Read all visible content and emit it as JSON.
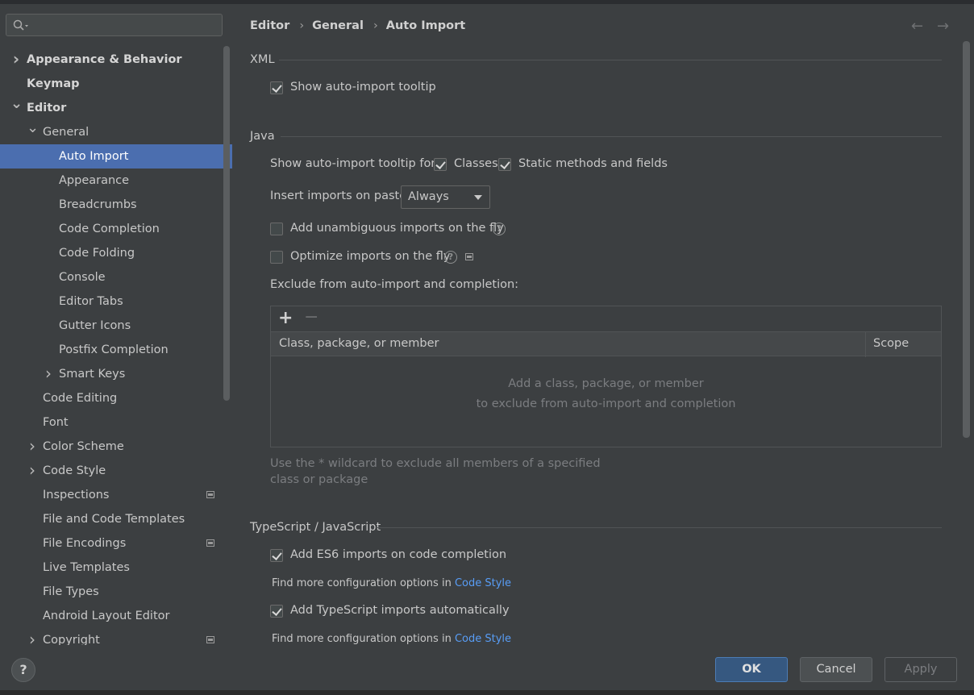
{
  "search": {
    "placeholder": ""
  },
  "sidebar": {
    "items": [
      {
        "label": "Appearance & Behavior",
        "level": 0,
        "bold": true,
        "chevron": ">"
      },
      {
        "label": "Keymap",
        "level": 0,
        "bold": true,
        "chevron": ""
      },
      {
        "label": "Editor",
        "level": 0,
        "bold": true,
        "chevron": "v"
      },
      {
        "label": "General",
        "level": 1,
        "bold": false,
        "chevron": "v"
      },
      {
        "label": "Auto Import",
        "level": 2,
        "bold": false,
        "chevron": "",
        "selected": true
      },
      {
        "label": "Appearance",
        "level": 2,
        "bold": false,
        "chevron": ""
      },
      {
        "label": "Breadcrumbs",
        "level": 2,
        "bold": false,
        "chevron": ""
      },
      {
        "label": "Code Completion",
        "level": 2,
        "bold": false,
        "chevron": ""
      },
      {
        "label": "Code Folding",
        "level": 2,
        "bold": false,
        "chevron": ""
      },
      {
        "label": "Console",
        "level": 2,
        "bold": false,
        "chevron": ""
      },
      {
        "label": "Editor Tabs",
        "level": 2,
        "bold": false,
        "chevron": ""
      },
      {
        "label": "Gutter Icons",
        "level": 2,
        "bold": false,
        "chevron": ""
      },
      {
        "label": "Postfix Completion",
        "level": 2,
        "bold": false,
        "chevron": ""
      },
      {
        "label": "Smart Keys",
        "level": 2,
        "bold": false,
        "chevron": ">"
      },
      {
        "label": "Code Editing",
        "level": 1,
        "bold": false,
        "chevron": ""
      },
      {
        "label": "Font",
        "level": 1,
        "bold": false,
        "chevron": ""
      },
      {
        "label": "Color Scheme",
        "level": 1,
        "bold": false,
        "chevron": ">"
      },
      {
        "label": "Code Style",
        "level": 1,
        "bold": false,
        "chevron": ">"
      },
      {
        "label": "Inspections",
        "level": 1,
        "bold": false,
        "chevron": "",
        "project_icon": true
      },
      {
        "label": "File and Code Templates",
        "level": 1,
        "bold": false,
        "chevron": ""
      },
      {
        "label": "File Encodings",
        "level": 1,
        "bold": false,
        "chevron": "",
        "project_icon": true
      },
      {
        "label": "Live Templates",
        "level": 1,
        "bold": false,
        "chevron": ""
      },
      {
        "label": "File Types",
        "level": 1,
        "bold": false,
        "chevron": ""
      },
      {
        "label": "Android Layout Editor",
        "level": 1,
        "bold": false,
        "chevron": ""
      },
      {
        "label": "Copyright",
        "level": 1,
        "bold": false,
        "chevron": ">",
        "project_icon": true
      }
    ]
  },
  "breadcrumb": {
    "items": [
      "Editor",
      "General",
      "Auto Import"
    ]
  },
  "xml": {
    "title": "XML",
    "show_tooltip_label": "Show auto-import tooltip",
    "show_tooltip_checked": true
  },
  "java": {
    "title": "Java",
    "tooltip_for_label": "Show auto-import tooltip for:",
    "classes_label": "Classes",
    "classes_checked": true,
    "static_label": "Static methods and fields",
    "static_checked": true,
    "insert_on_paste_label": "Insert imports on paste:",
    "insert_on_paste_value": "Always",
    "unambiguous_label": "Add unambiguous imports on the fly",
    "unambiguous_checked": false,
    "optimize_label": "Optimize imports on the fly",
    "optimize_checked": false,
    "exclude_label": "Exclude from auto-import and completion:",
    "add_symbol": "+",
    "remove_symbol": "−",
    "col_member": "Class, package, or member",
    "col_scope": "Scope",
    "empty_line1": "Add a class, package, or member",
    "empty_line2": "to exclude from auto-import and completion",
    "hint": "Use the * wildcard to exclude all members of a specified class or package"
  },
  "ts": {
    "title": "TypeScript / JavaScript",
    "es6_label": "Add ES6 imports on code completion",
    "es6_checked": true,
    "more_prefix": "Find more configuration options in ",
    "more_link": "Code Style",
    "ts_auto_label": "Add TypeScript imports automatically",
    "ts_auto_checked": true
  },
  "buttons": {
    "help": "?",
    "ok": "OK",
    "cancel": "Cancel",
    "apply": "Apply"
  },
  "colors": {
    "selection": "#4b6eaf",
    "link": "#589df6",
    "ok_button": "#365880"
  }
}
